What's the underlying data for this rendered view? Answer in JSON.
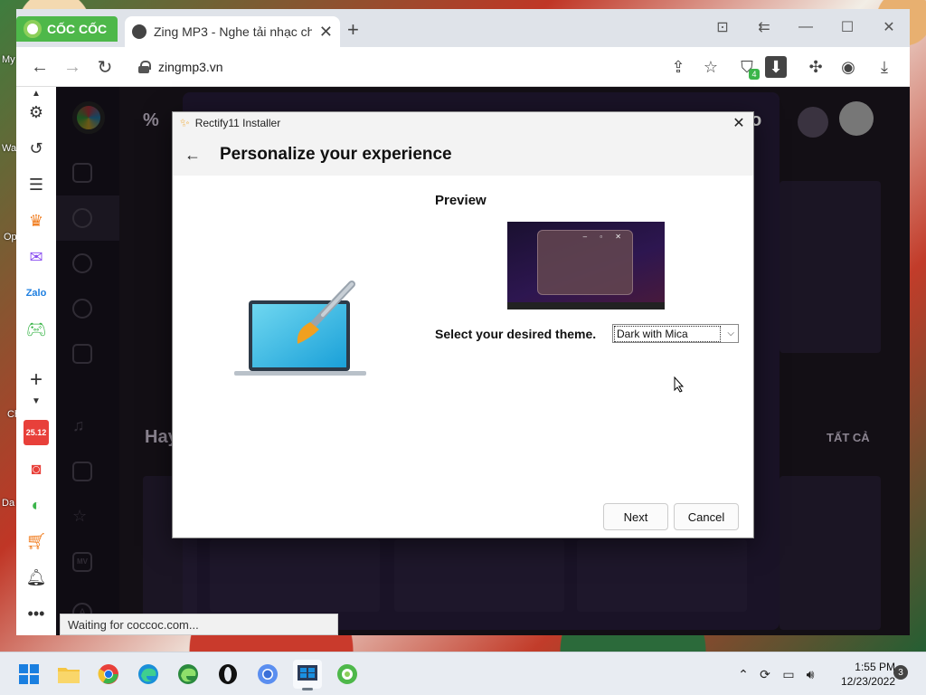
{
  "desktop": {
    "labels": [
      "My",
      "Wa",
      "Op",
      "Ch",
      "Da"
    ]
  },
  "browser": {
    "brand_tab": "CỐC CỐC",
    "tab_title": "Zing MP3 - Nghe tải nhạc ch",
    "tab_close": "✕",
    "new_tab": "+",
    "window_controls": [
      "⊡",
      "⇇",
      "—",
      "☐",
      "✕"
    ],
    "address": "zingmp3.vn",
    "extension_badge": "4",
    "status_text": "Waiting for coccoc.com...",
    "icons": [
      "back-icon",
      "forward-icon",
      "reload-icon",
      "share-icon",
      "star-icon",
      "shield-icon",
      "download-icon",
      "extensions-icon",
      "profile-icon",
      "downloads-icon"
    ]
  },
  "side_panel": {
    "icons": [
      "settings-icon",
      "history-icon",
      "list-icon",
      "crown-icon",
      "messenger-icon",
      "zalo-icon",
      "game-icon",
      "add-icon",
      "calendar-icon",
      "news-icon",
      "coccoc-icon",
      "shop-icon",
      "bell-icon",
      "more-icon"
    ],
    "calendar_date": "25.12"
  },
  "zing": {
    "partial_text_top": "%",
    "partial_text_right": "o",
    "heading_partial": "Hay",
    "see_all": "TẤT CẢ",
    "nav_letter": "A",
    "mv_label": "MV"
  },
  "dialog": {
    "app_title": "Rectify11 Installer",
    "close": "✕",
    "back": "←",
    "heading": "Personalize your experience",
    "preview_label": "Preview",
    "preview_controls": "– ▫ ✕",
    "theme_label": "Select your desired theme.",
    "theme_value": "Dark with Mica",
    "next": "Next",
    "cancel": "Cancel"
  },
  "taskbar": {
    "apps": [
      "start-icon",
      "file-explorer-icon",
      "chrome-icon",
      "edge-icon",
      "edge-dev-icon",
      "opera-icon",
      "chrome-canary-icon",
      "installer-icon",
      "coccoc-icon"
    ],
    "tray": [
      "chevron-up-icon",
      "sync-icon",
      "network-icon",
      "volume-icon"
    ],
    "time": "1:55 PM",
    "date": "12/23/2022",
    "notification_count": "3"
  },
  "colors": {
    "coccoc_green": "#4eb84a",
    "zing_bg": "#2a2230",
    "zing_purple": "#3b2b58"
  }
}
